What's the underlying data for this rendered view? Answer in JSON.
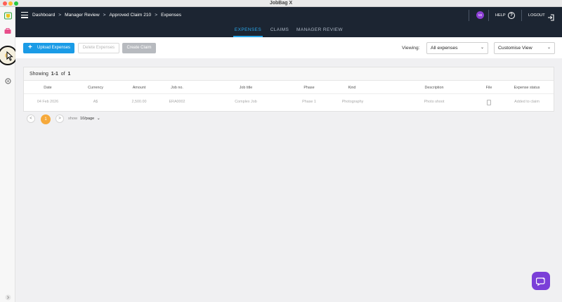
{
  "window": {
    "title": "JobBag X"
  },
  "breadcrumb": [
    "Dashboard",
    "Manager Review",
    "Approved Claim 210",
    "Expenses"
  ],
  "breadcrumb_separator": ">",
  "header": {
    "avatar_initials": "MI",
    "avatar_color": "#8c3fd4",
    "help_label": "HELP",
    "logout_label": "LOGOUT"
  },
  "tabs": [
    {
      "label": "EXPENSES",
      "active": true
    },
    {
      "label": "CLAIMS",
      "active": false
    },
    {
      "label": "MANAGER REVIEW",
      "active": false
    }
  ],
  "toolbar": {
    "upload_label": "Upload Expenses",
    "delete_label": "Delete Expenses",
    "create_claim_label": "Create Claim",
    "viewing_label": "Viewing:",
    "viewing_value": "All expenses",
    "customise_label": "Customise View"
  },
  "table": {
    "showing_prefix": "Showing",
    "showing_range": "1-1",
    "showing_of": "of",
    "showing_total": "1",
    "columns": [
      "Date",
      "Currency",
      "Amount",
      "Job no.",
      "Job title",
      "Phase",
      "Kind",
      "Description",
      "File",
      "Expense status"
    ],
    "rows": [
      [
        "04 Feb 2026",
        "A$",
        "2,500.00",
        "ERA0002",
        "Complex Job",
        "Phase 1",
        "Photography",
        "Photo shoot",
        "",
        "Added to claim"
      ]
    ]
  },
  "pagination": {
    "prev": "<",
    "current_page": "1",
    "next": ">",
    "show_label": "show",
    "page_size": "10/page"
  },
  "colors": {
    "header_bg": "#1c2532",
    "accent": "#1a9be6",
    "active_tab": "#2aa7ea",
    "page_badge": "#f6a93b",
    "chat_fab": "#7b3fd8"
  }
}
